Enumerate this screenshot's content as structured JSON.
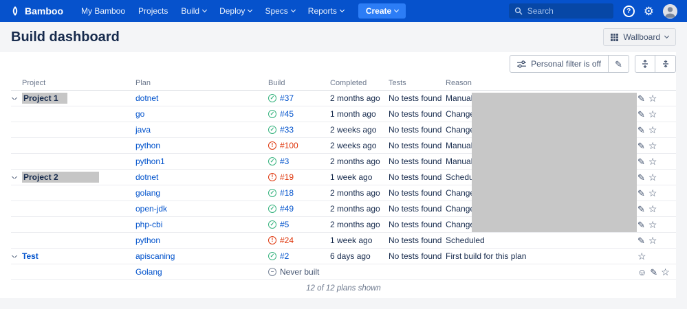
{
  "navbar": {
    "brand": "Bamboo",
    "menu": [
      {
        "label": "My Bamboo"
      },
      {
        "label": "Projects"
      },
      {
        "label": "Build"
      },
      {
        "label": "Deploy"
      },
      {
        "label": "Specs"
      },
      {
        "label": "Reports"
      }
    ],
    "create_label": "Create",
    "search_placeholder": "Search"
  },
  "header": {
    "title": "Build dashboard",
    "wallboard_label": "Wallboard"
  },
  "toolbar": {
    "filter_label": "Personal filter is off"
  },
  "icons": {
    "success": "✓",
    "failed": "!",
    "never_built": "−",
    "edit": "✎",
    "star": "☆",
    "smiley": "☺"
  },
  "colors": {
    "navbar_bg": "#0652CC",
    "create_button_bg": "#2C7DF6",
    "link": "#0052CC",
    "success": "#36B37E",
    "failed": "#DE350B",
    "page_header_bg": "#F4F5F7",
    "redaction": "#C7C7C7"
  },
  "table": {
    "columns": {
      "project": "Project",
      "plan": "Plan",
      "build": "Build",
      "completed": "Completed",
      "tests": "Tests",
      "reason": "Reason"
    },
    "rows": [
      {
        "group": "Project 1",
        "group_style": "redacted",
        "group_minwidth": 66,
        "plan": "dotnet",
        "status": "success",
        "build": "#37",
        "completed": "2 months ago",
        "tests": "No tests found",
        "reason": "Manual run",
        "actions": [
          "edit",
          "star"
        ]
      },
      {
        "group": "",
        "plan": "go",
        "status": "success",
        "build": "#45",
        "completed": "1 month ago",
        "tests": "No tests found",
        "reason": "Changes by",
        "actions": [
          "edit",
          "star"
        ]
      },
      {
        "group": "",
        "plan": "java",
        "status": "success",
        "build": "#33",
        "completed": "2 weeks ago",
        "tests": "No tests found",
        "reason": "Changes by",
        "actions": [
          "edit",
          "star"
        ]
      },
      {
        "group": "",
        "plan": "python",
        "status": "fail",
        "build": "#100",
        "completed": "2 weeks ago",
        "tests": "No tests found",
        "reason": "Manual run",
        "actions": [
          "edit",
          "star"
        ]
      },
      {
        "group": "",
        "plan": "python1",
        "status": "success",
        "build": "#3",
        "completed": "2 months ago",
        "tests": "No tests found",
        "reason": "Manual run",
        "actions": [
          "edit",
          "star"
        ]
      },
      {
        "group": "Project 2",
        "group_style": "redacted",
        "group_minwidth": 112,
        "plan": "dotnet",
        "status": "fail",
        "build": "#19",
        "completed": "1 week ago",
        "tests": "No tests found",
        "reason": "Scheduled",
        "actions": [
          "edit",
          "star"
        ]
      },
      {
        "group": "",
        "plan": "golang",
        "status": "success",
        "build": "#18",
        "completed": "2 months ago",
        "tests": "No tests found",
        "reason": "Changes by",
        "actions": [
          "edit",
          "star"
        ]
      },
      {
        "group": "",
        "plan": "open-jdk",
        "status": "success",
        "build": "#49",
        "completed": "2 months ago",
        "tests": "No tests found",
        "reason": "Changes by",
        "actions": [
          "edit",
          "star"
        ]
      },
      {
        "group": "",
        "plan": "php-cbi",
        "status": "success",
        "build": "#5",
        "completed": "2 months ago",
        "tests": "No tests found",
        "reason": "Changes by",
        "actions": [
          "edit",
          "star"
        ]
      },
      {
        "group": "",
        "plan": "python",
        "status": "fail",
        "build": "#24",
        "completed": "1 week ago",
        "tests": "No tests found",
        "reason": "Scheduled",
        "actions": [
          "edit",
          "star"
        ]
      },
      {
        "group": "Test",
        "group_style": "link",
        "plan": "apiscaning",
        "status": "success",
        "build": "#2",
        "completed": "6 days ago",
        "tests": "No tests found",
        "reason": "First build for this plan",
        "actions": [
          "star"
        ]
      },
      {
        "group": "",
        "plan": "Golang",
        "status": "never",
        "build": "Never built",
        "completed": "",
        "tests": "",
        "reason": "",
        "actions": [
          "smiley",
          "edit",
          "star"
        ]
      }
    ],
    "footer": "12 of 12 plans shown"
  }
}
